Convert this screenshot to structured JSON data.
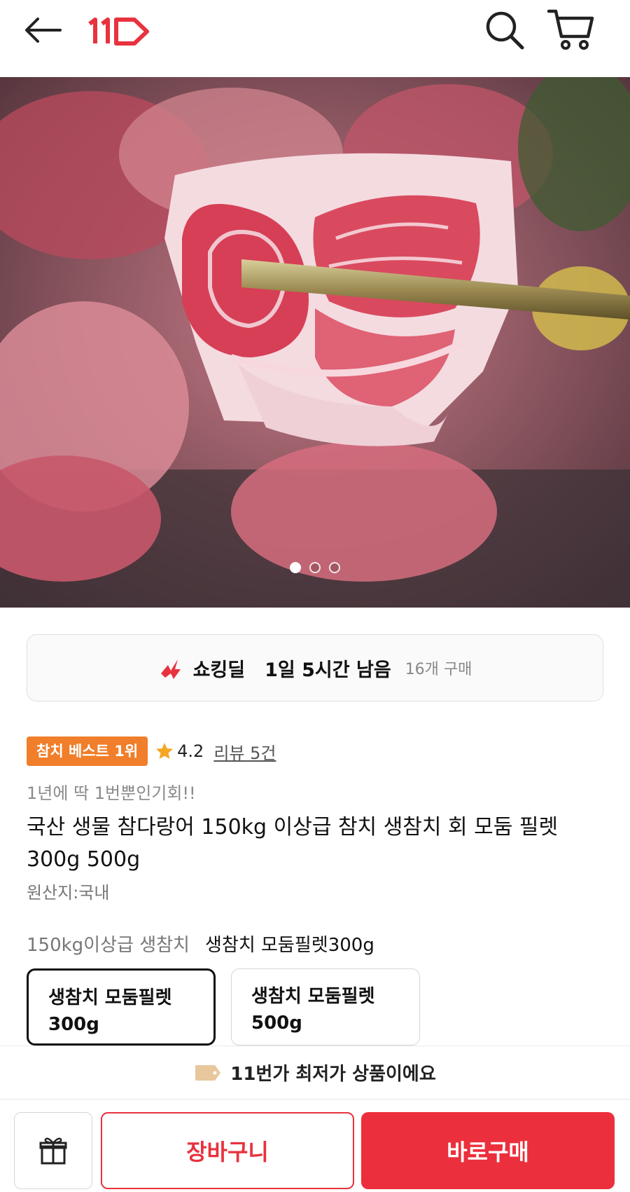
{
  "header": {
    "logo_text": "11",
    "brand_color": "#e8323e"
  },
  "hero": {
    "dots_total": 3,
    "active_index": 0
  },
  "deal": {
    "label": "쇼킹딜",
    "time_left": "1일 5시간 남음",
    "purchase_count": "16개 구매"
  },
  "product": {
    "best_badge": "참치 베스트 1위",
    "rating": "4.2",
    "review_link": "리뷰 5건",
    "promo": "1년에 딱 1번뿐인기회!!",
    "title": "국산 생물 참다랑어 150kg 이상급 참치 생참치 회 모둠 필렛 300g 500g",
    "origin": "원산지:국내",
    "option_group": "150kg이상급 생참치",
    "option_selected": "생참치 모둠필렛300g",
    "options": [
      {
        "label": "생참치 모둠필렛 300g",
        "selected": true
      },
      {
        "label": "생참치 모둠필렛 500g",
        "selected": false
      }
    ]
  },
  "lowest_price_banner": "11번가 최저가 상품이에요",
  "actions": {
    "cart_label": "장바구니",
    "buy_label": "바로구매"
  },
  "colors": {
    "accent_red": "#ec2f3c",
    "badge_orange": "#f07e2a",
    "star_yellow": "#f5a623"
  },
  "icons": [
    "back-arrow-icon",
    "search-icon",
    "cart-icon",
    "deal-flash-icon",
    "star-icon",
    "price-tag-icon",
    "gift-icon"
  ]
}
